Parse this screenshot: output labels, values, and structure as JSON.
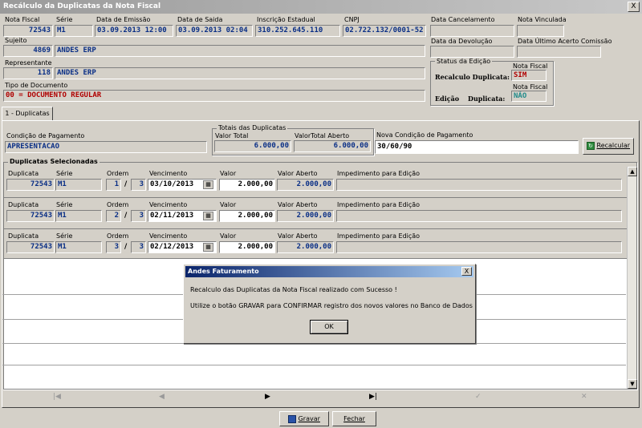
{
  "window": {
    "title": "Recálculo da Duplicatas da Nota Fiscal",
    "close": "X"
  },
  "header": {
    "nota_fiscal_label": "Nota Fiscal",
    "nota_fiscal": "72543",
    "serie_label": "Série",
    "serie": "M1",
    "emissao_label": "Data de Emissão",
    "emissao": "03.09.2013 12:00",
    "saida_label": "Data de Saida",
    "saida": "03.09.2013 02:04",
    "ie_label": "Inscrição Estadual",
    "ie": "310.252.645.110",
    "cnpj_label": "CNPJ",
    "cnpj": "02.722.132/0001-52",
    "cancelamento_label": "Data Cancelamento",
    "cancelamento": "",
    "nota_vinculada_label": "Nota Vinculada",
    "nota_vinculada": "",
    "sujeito_label": "Sujeito",
    "sujeito_cod": "4869",
    "sujeito_nome": "ANDES ERP",
    "devolucao_label": "Data da Devolução",
    "devolucao": "",
    "acerto_label": "Data Último Acerto Comissão",
    "acerto": "",
    "representante_label": "Representante",
    "representante_cod": "118",
    "representante_nome": "ANDES ERP",
    "tipo_doc_label": "Tipo de Documento",
    "tipo_doc": "00 = DOCUMENTO REGULAR"
  },
  "status": {
    "title": "Status da Edição",
    "nota_fiscal_label1": "Nota Fiscal",
    "recalculo_label": "Recalculo Duplicata:",
    "recalculo_value": "SIM",
    "nota_fiscal_label2": "Nota Fiscal",
    "edicao_label": "Edição",
    "duplicata_label": "Duplicata:",
    "edicao_value": "NÃO"
  },
  "tabs": [
    {
      "label": "1 - Duplicatas"
    }
  ],
  "payment": {
    "cond_label": "Condição de Pagamento",
    "cond": "APRESENTACAO",
    "totais_title": "Totais das Duplicatas",
    "valor_total_label": "Valor Total",
    "valor_total": "6.000,00",
    "valor_aberto_label": "ValorTotal Aberto",
    "valor_aberto": "6.000,00",
    "nova_cond_label": "Nova Condição de Pagamento",
    "nova_cond": "30/60/90",
    "recalcular_label": "Recalcular"
  },
  "duplicatas": {
    "title": "Duplicatas Selecionadas",
    "col_duplicata": "Duplicata",
    "col_serie": "Série",
    "col_ordem": "Ordem",
    "col_vencimento": "Vencimento",
    "col_valor": "Valor",
    "col_aberto": "Valor Aberto",
    "col_impedimento": "Impedimento para Edição",
    "rows": [
      {
        "duplicata": "72543",
        "serie": "M1",
        "ordem": "1",
        "sep": "/",
        "total": "3",
        "vencimento": "03/10/2013",
        "valor": "2.000,00",
        "aberto": "2.000,00",
        "impedimento": ""
      },
      {
        "duplicata": "72543",
        "serie": "M1",
        "ordem": "2",
        "sep": "/",
        "total": "3",
        "vencimento": "02/11/2013",
        "valor": "2.000,00",
        "aberto": "2.000,00",
        "impedimento": ""
      },
      {
        "duplicata": "72543",
        "serie": "M1",
        "ordem": "3",
        "sep": "/",
        "total": "3",
        "vencimento": "02/12/2013",
        "valor": "2.000,00",
        "aberto": "2.000,00",
        "impedimento": ""
      }
    ]
  },
  "navigator": [
    "first-icon",
    "prior-icon",
    "next-icon",
    "last-icon",
    "post-icon",
    "cancel-icon"
  ],
  "dialog": {
    "title": "Andes Faturamento",
    "close": "X",
    "line1": "Recalculo das Duplicatas da Nota Fiscal realizado com Sucesso !",
    "line2": "Utilize o botão GRAVAR para CONFIRMAR registro dos novos valores no Banco de Dados",
    "ok": "OK"
  },
  "footer": {
    "gravar": "Gravar",
    "fechar": "Fechar"
  },
  "colors": {
    "title_blue": "#0a246a",
    "value_blue": "#0a2f86",
    "value_red": "#b00000"
  }
}
